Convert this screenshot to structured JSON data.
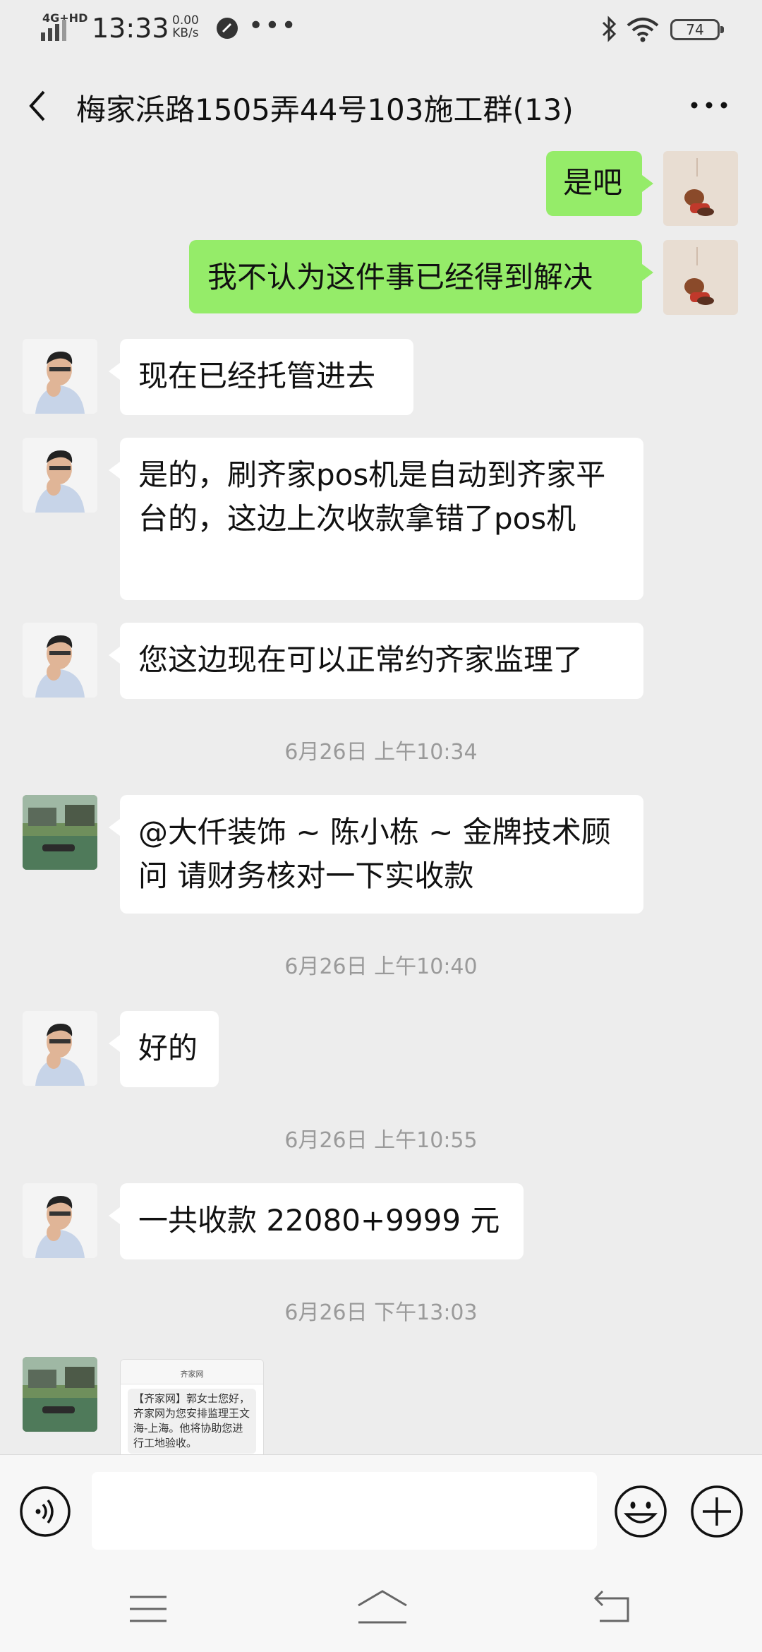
{
  "status_bar": {
    "network": "4G+HD",
    "time": "13:33",
    "speed_value": "0.00",
    "speed_unit": "KB/s",
    "more": "•••",
    "battery": "74"
  },
  "header": {
    "title": "梅家浜路1505弄44号103施工群(13)"
  },
  "messages": [
    {
      "side": "out",
      "text": "是吧"
    },
    {
      "side": "out",
      "text": "我不认为这件事已经得到解决"
    },
    {
      "side": "in",
      "text": "现在已经托管进去"
    },
    {
      "side": "in",
      "text": "是的，刷齐家pos机是自动到齐家平台的，这边上次收款拿错了pos机"
    },
    {
      "side": "in",
      "text": "您这边现在可以正常约齐家监理了"
    },
    {
      "side": "in",
      "text": "@大仟装饰 ~ 陈小栋 ~ 金牌技术顾问  请财务核对一下实收款"
    },
    {
      "side": "in",
      "text": "好的"
    },
    {
      "side": "in",
      "text": "一共收款 22080+9999 元"
    }
  ],
  "timestamps": [
    "6月26日 上午10:34",
    "6月26日 上午10:40",
    "6月26日 上午10:55",
    "6月26日 下午13:03"
  ],
  "screenshot_thumb": {
    "header": "齐家网",
    "text": "【齐家网】郭女士您好，齐家网为您安排监理王文海-上海。他将协助您进行工地验收。"
  },
  "colors": {
    "background": "#ededed",
    "outgoing_bubble": "#95ec69",
    "incoming_bubble": "#ffffff",
    "timestamp": "#9a9a9a"
  },
  "icons": [
    "back-icon",
    "more-icon",
    "voice-icon",
    "emoji-icon",
    "plus-icon",
    "menu-icon",
    "home-icon",
    "return-icon"
  ]
}
